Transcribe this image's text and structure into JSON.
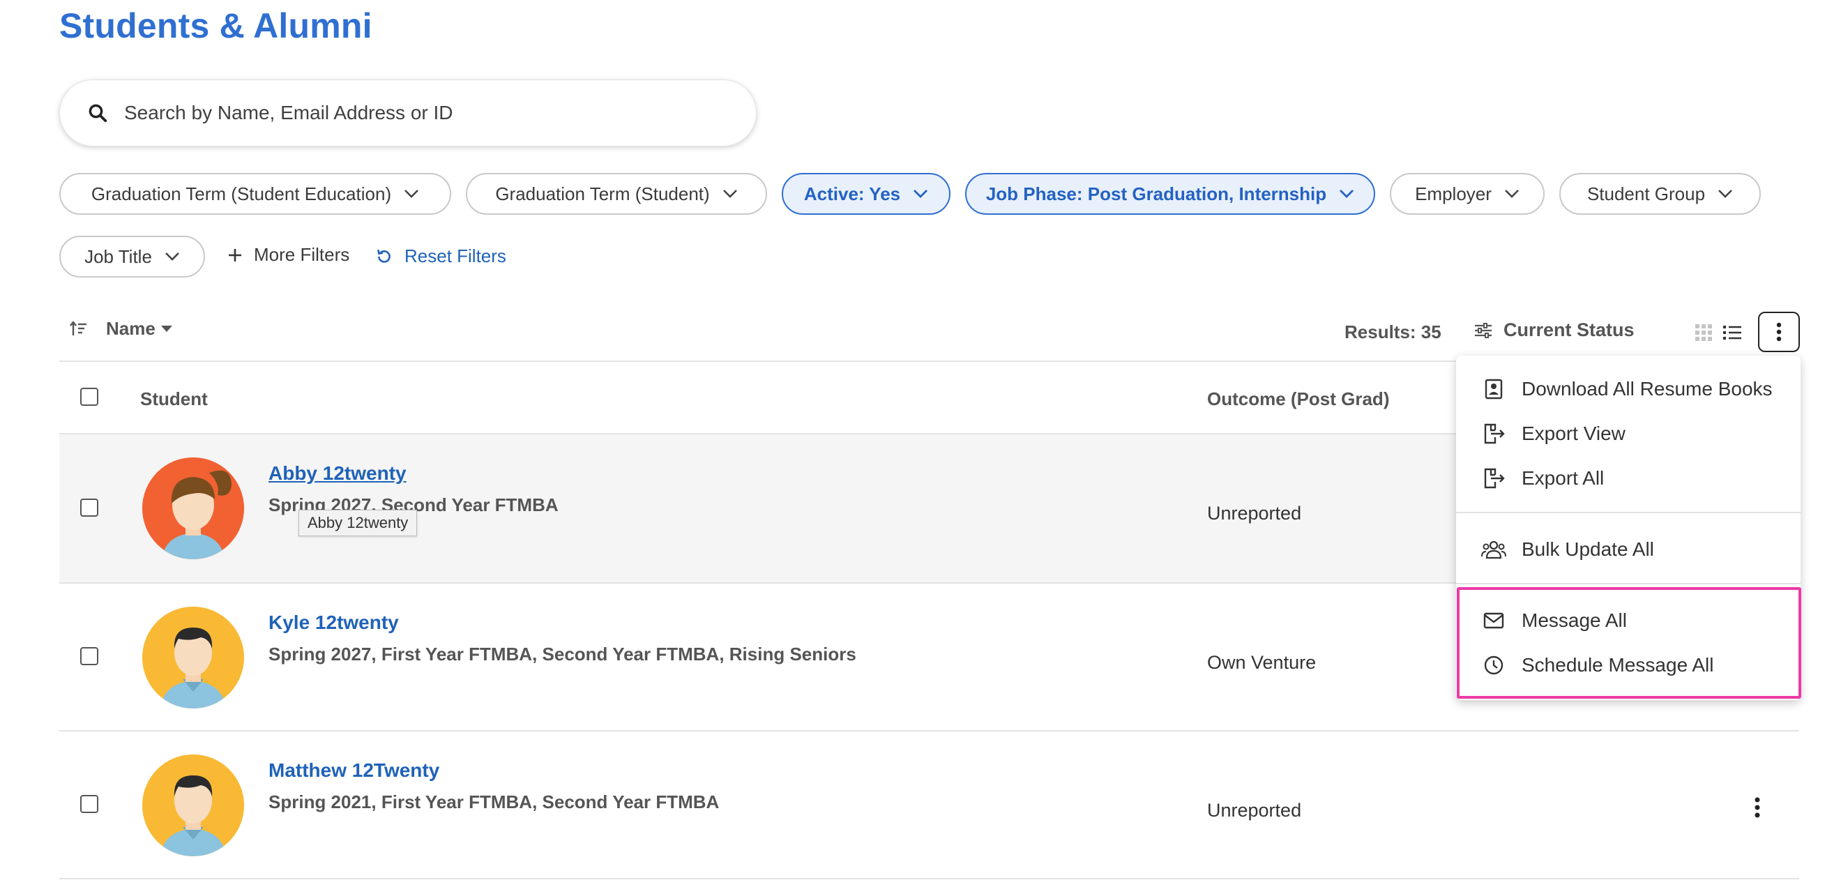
{
  "page": {
    "title": "Students & Alumni"
  },
  "search": {
    "placeholder": "Search by Name, Email Address or ID",
    "value": ""
  },
  "filters": [
    {
      "label": "Graduation Term (Student Education)",
      "active": false
    },
    {
      "label": "Graduation Term (Student)",
      "active": false
    },
    {
      "label": "Active: Yes",
      "active": true
    },
    {
      "label": "Job Phase: Post Graduation, Internship",
      "active": true
    },
    {
      "label": "Employer",
      "active": false
    },
    {
      "label": "Student Group",
      "active": false
    },
    {
      "label": "Job Title",
      "active": false
    }
  ],
  "filter_actions": {
    "more_filters": "More Filters",
    "reset_filters": "Reset Filters"
  },
  "toolbar": {
    "sort_label": "Name",
    "results": "Results: 35",
    "status_label": "Current Status"
  },
  "table": {
    "columns": {
      "student": "Student",
      "outcome": "Outcome (Post Grad)"
    },
    "rows": [
      {
        "name": "Abby 12twenty",
        "detail": "Spring 2027, Second Year FTMBA",
        "outcome": "Unreported",
        "avatar": "female-avatar"
      },
      {
        "name": "Kyle 12twenty",
        "detail": "Spring 2027, First Year FTMBA, Second Year FTMBA, Rising Seniors",
        "outcome": "Own Venture",
        "avatar": "male-avatar"
      },
      {
        "name": "Matthew 12Twenty",
        "detail": "Spring 2021, First Year FTMBA, Second Year FTMBA",
        "outcome": "Unreported",
        "avatar": "male-avatar"
      }
    ]
  },
  "tooltip": {
    "text": "Abby 12twenty"
  },
  "menu": {
    "items": [
      {
        "label": "Download All Resume Books",
        "icon": "resume-book-icon"
      },
      {
        "label": "Export View",
        "icon": "export-icon"
      },
      {
        "label": "Export All",
        "icon": "export-icon"
      },
      {
        "label": "Bulk Update All",
        "icon": "users-icon"
      },
      {
        "label": "Message All",
        "icon": "envelope-icon"
      },
      {
        "label": "Schedule Message All",
        "icon": "clock-icon"
      }
    ]
  },
  "colors": {
    "accent": "#2f6fd1",
    "highlight": "#ec3aa7",
    "avatar_orange": "#f26131",
    "avatar_yellow": "#f9b934"
  }
}
